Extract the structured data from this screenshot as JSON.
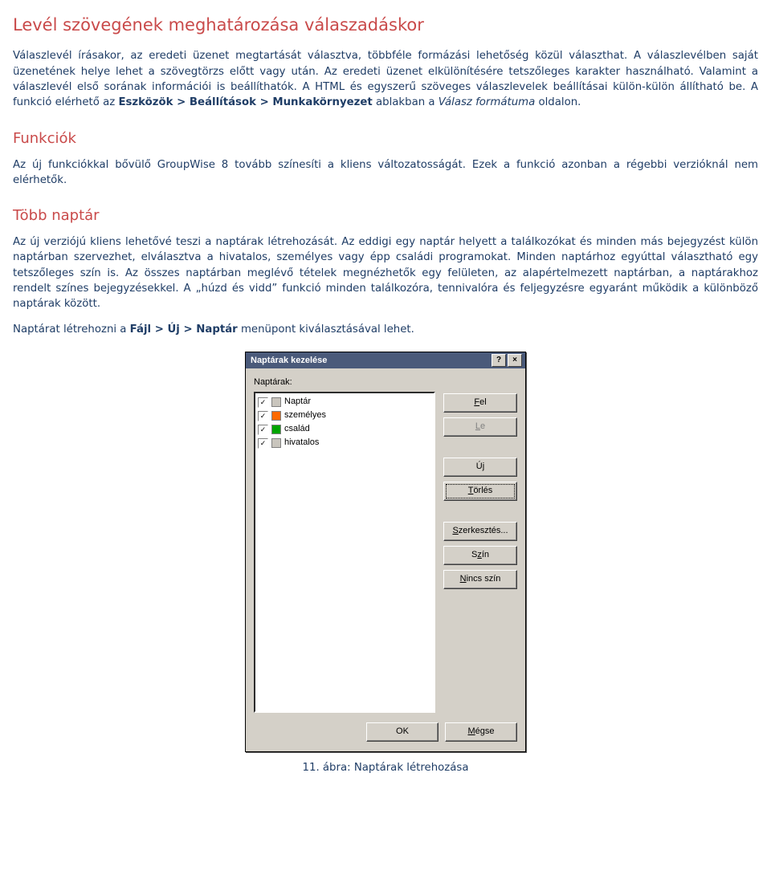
{
  "sec1": {
    "title": "Levél szövegének meghatározása válaszadáskor",
    "p1a": "Válaszlevél írásakor, az eredeti üzenet megtartását választva, többféle formázási lehetőség közül választhat. A válaszlevélben saját üzenetének helye lehet a szövegtörzs előtt vagy után. Az eredeti üzenet elkülönítésére tetszőleges karakter használható. Valamint a válaszlevél első sorának információi is beállíthatók. A HTML és egyszerű szöveges válaszlevelek beállításai külön-külön állítható be. A funkció elérhető az ",
    "p1b": "Eszközök > Beállítások > Munkakörnyezet",
    "p1c": " ablakban a ",
    "p1d": "Válasz formátuma",
    "p1e": " oldalon."
  },
  "sec2": {
    "title": "Funkciók",
    "p1": "Az új funkciókkal bővülő GroupWise 8 tovább színesíti a kliens változatosságát. Ezek a funkció azonban a régebbi verzióknál nem elérhetők."
  },
  "sec3": {
    "title": "Több naptár",
    "p1": "Az új verziójú kliens lehetővé teszi a naptárak létrehozását. Az eddigi egy naptár helyett a találkozókat és minden más bejegyzést külön naptárban szervezhet, elválasztva a hivatalos, személyes vagy épp családi programokat. Minden naptárhoz egyúttal választható egy tetszőleges szín is. Az összes naptárban meglévő tételek megnézhetők egy felületen, az alapértelmezett naptárban, a naptárakhoz rendelt színes bejegyzésekkel. A „húzd és vidd” funkció minden találkozóra, tennivalóra és feljegyzésre egyaránt működik a különböző naptárak között.",
    "p2a": "Naptárat létrehozni a ",
    "p2b": "Fájl > Új > Naptár",
    "p2c": " menüpont kiválasztásával lehet."
  },
  "dialog": {
    "title": "Naptárak kezelése",
    "list_label": "Naptárak:",
    "items": [
      {
        "label": "Naptár",
        "color": "#c9c5bd"
      },
      {
        "label": "személyes",
        "color": "#ff6a00"
      },
      {
        "label": "család",
        "color": "#00a400"
      },
      {
        "label": "hivatalos",
        "color": "#c9c5bd"
      }
    ],
    "buttons": {
      "up": "Fel",
      "down": "Le",
      "new": "Új",
      "delete": "Törlés",
      "edit": "Szerkesztés...",
      "color": "Szín",
      "nocolor": "Nincs szín",
      "ok": "OK",
      "cancel": "Mégse"
    }
  },
  "figure_caption": "11. ábra: Naptárak létrehozása"
}
